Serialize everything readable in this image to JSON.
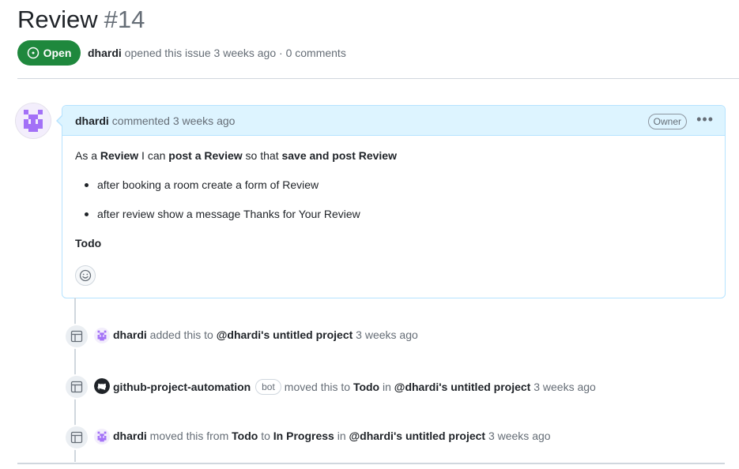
{
  "issue": {
    "title": "Review",
    "number": "#14",
    "state": "Open",
    "author": "dhardi",
    "meta_text": "opened this issue 3 weeks ago · 0 comments"
  },
  "comment": {
    "author": "dhardi",
    "action": "commented 3 weeks ago",
    "role_badge": "Owner",
    "menu_icon": "kebab-horizontal-icon",
    "story": {
      "p1": "As a ",
      "b1": "Review",
      "p2": " I can ",
      "b2": "post a Review",
      "p3": " so that ",
      "b3": "save and post Review"
    },
    "bullets": [
      "after booking a room create a form of Review",
      "after review show a message Thanks for Your Review"
    ],
    "footer_bold": "Todo",
    "reaction_icon": "smiley-icon"
  },
  "timeline": [
    {
      "icon": "project-table-icon",
      "actor": "dhardi",
      "parts": [
        "added this to ",
        "@dhardi's untitled project",
        " 3 weeks ago"
      ]
    },
    {
      "icon": "project-table-icon",
      "actor": "github-project-automation",
      "badge": "bot",
      "parts": [
        "moved this to ",
        "Todo",
        " in ",
        "@dhardi's untitled project",
        " 3 weeks ago"
      ]
    },
    {
      "icon": "project-table-icon",
      "actor": "dhardi",
      "parts": [
        "moved this from ",
        "Todo",
        " to ",
        "In Progress",
        " in ",
        "@dhardi's untitled project",
        " 3 weeks ago"
      ]
    }
  ],
  "colors": {
    "open_green": "#1f883d",
    "comment_header_bg": "#ddf4ff",
    "comment_border": "#b6e3ff",
    "avatar_purple": "#a371f7"
  }
}
